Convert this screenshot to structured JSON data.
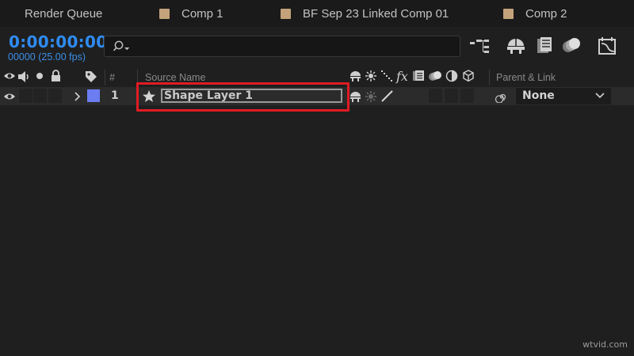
{
  "tabs": [
    {
      "label": "Render Queue",
      "has_swatch": false
    },
    {
      "label": "Comp 1",
      "has_swatch": true
    },
    {
      "label": "BF Sep 23 Linked Comp 01",
      "has_swatch": true
    },
    {
      "label": "Comp 2",
      "has_swatch": true
    }
  ],
  "timecode": {
    "value": "0:00:00:00",
    "frames": "00000 (25.00 fps)"
  },
  "search": {
    "value": "",
    "placeholder": ""
  },
  "toolbar": {
    "icons": [
      "comp-flowchart-icon",
      "draft-3d-icon",
      "frame-blending-icon",
      "motion-blur-icon",
      "graph-editor-icon"
    ]
  },
  "columns": {
    "number": "#",
    "source_name": "Source Name",
    "parent_link": "Parent & Link",
    "switch_icons": [
      "shy-icon",
      "collapse-icon",
      "quality-icon",
      "fx-icon",
      "frame-blend-icon",
      "motion-blur-icon",
      "adjustment-icon",
      "3d-layer-icon"
    ]
  },
  "layer": {
    "index": "1",
    "name": "Shape Layer 1",
    "label_color": "#6b7df0",
    "parent": "None"
  },
  "colors": {
    "timecode": "#2f8cf2",
    "highlight": "#e01b24",
    "tab_swatch": "#c4a27a"
  },
  "watermark": "wtvid.com"
}
